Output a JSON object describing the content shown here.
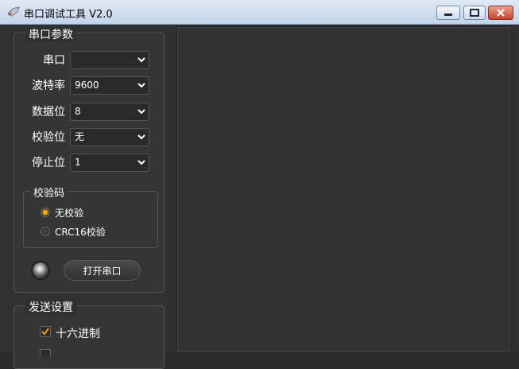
{
  "window": {
    "title": "串口调试工具 V2.0",
    "icon": "serial-tool-icon",
    "controls": {
      "minimize": "minimize-icon",
      "maximize": "maximize-icon",
      "close": "close-icon"
    }
  },
  "serial_params": {
    "title": "串口参数",
    "rows": [
      {
        "label": "串口",
        "value": ""
      },
      {
        "label": "波特率",
        "value": "9600"
      },
      {
        "label": "数据位",
        "value": "8"
      },
      {
        "label": "校验位",
        "value": "无"
      },
      {
        "label": "停止位",
        "value": "1"
      }
    ],
    "checksum": {
      "title": "校验码",
      "options": [
        {
          "label": "无校验",
          "selected": true
        },
        {
          "label": "CRC16校验",
          "selected": false
        }
      ]
    },
    "open_button": "打开串口",
    "status_led": "status-led"
  },
  "send_settings": {
    "title": "发送设置",
    "hex_label": "十六进制",
    "hex_checked": true
  },
  "colors": {
    "accent": "#e89a10",
    "panel": "#353535",
    "background": "#303030"
  }
}
